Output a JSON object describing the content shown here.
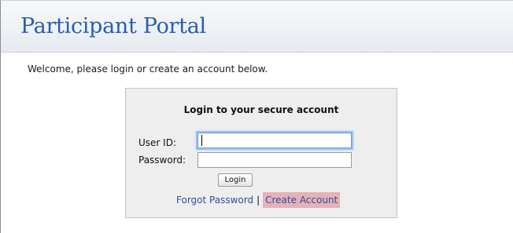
{
  "header": {
    "title": "Participant Portal"
  },
  "welcome_text": "Welcome, please login or create an account below.",
  "login_box": {
    "heading": "Login to your secure account",
    "user_id_label": "User ID:",
    "user_id_value": "",
    "password_label": "Password:",
    "password_value": "",
    "login_button_label": "Login",
    "forgot_password_label": "Forgot Password",
    "separator": "|",
    "create_account_label": "Create Account"
  },
  "colors": {
    "title_blue": "#2a5db0",
    "link_blue": "#2c4fa0",
    "create_account_highlight": "#e6b1b8",
    "box_background": "#eeeeee"
  }
}
